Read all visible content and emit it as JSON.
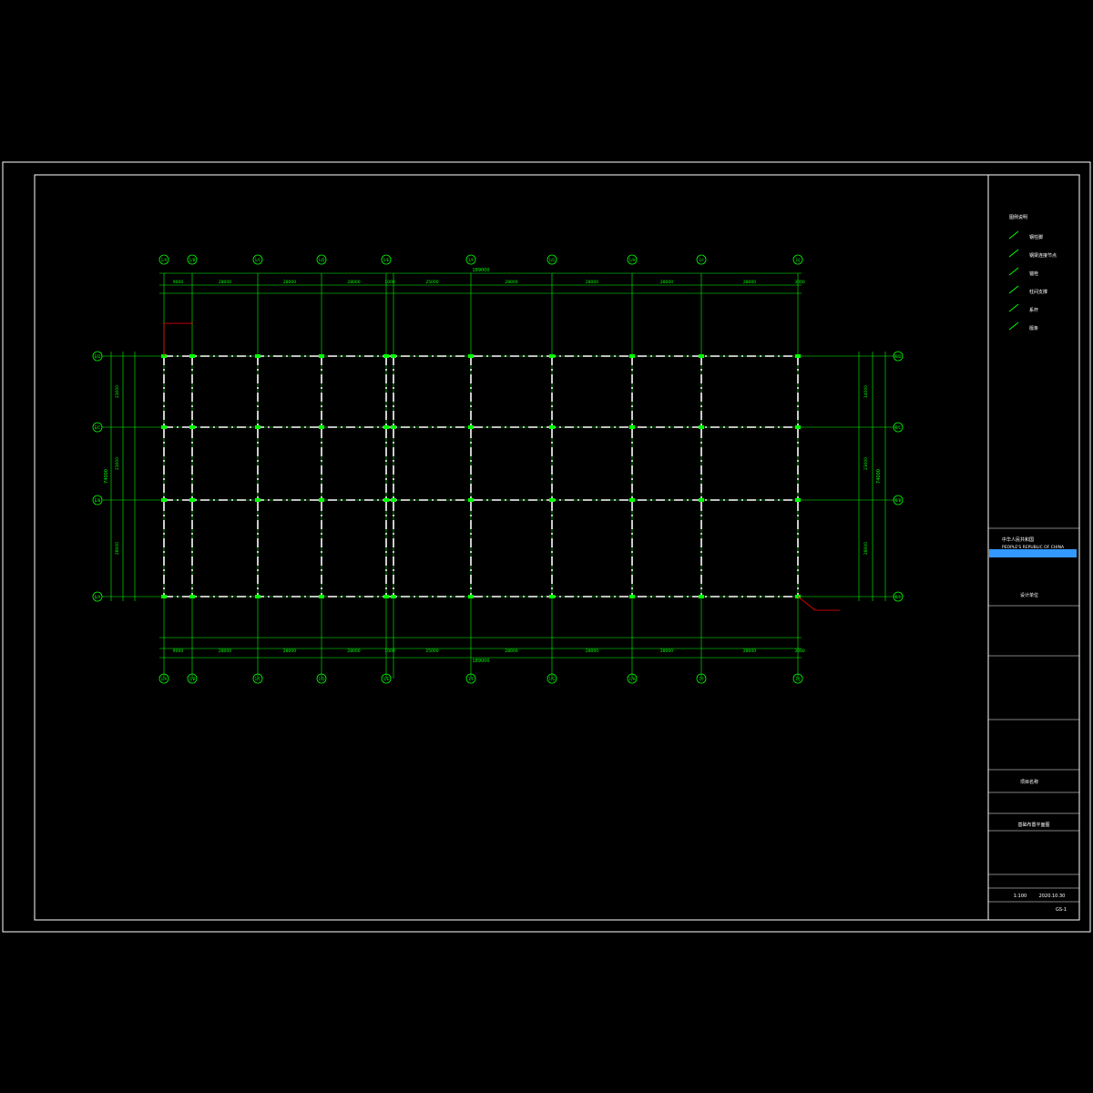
{
  "grid": {
    "top_axes": [
      "1/A",
      "1/B",
      "1/C",
      "1/D",
      "1/E",
      "1/F",
      "1/G",
      "1/H",
      "1/I",
      "1/J"
    ],
    "side_axes": [
      "E/D",
      "E/C",
      "E/B",
      "E/A"
    ]
  },
  "dims": {
    "top_row1": [
      "9000",
      "28000",
      "28000",
      "28000",
      "1000",
      "25000",
      "28000",
      "28000",
      "28000",
      "28000",
      "3000"
    ],
    "top_total": "189000",
    "bottom_row": [
      "9000",
      "28000",
      "28000",
      "28000",
      "1000",
      "25000",
      "28000",
      "28000",
      "28000",
      "28000",
      "3000"
    ],
    "bottom_total": "189000",
    "left_span": [
      "23000",
      "23000",
      "28000"
    ],
    "left_total": "74000",
    "right_span": [
      "14000",
      "23000",
      "28000"
    ],
    "right_total": "74000"
  },
  "legend": {
    "title": "图例说明",
    "items": [
      "钢柱脚",
      "钢梁连接节点",
      "锚栓",
      "柱间支撑",
      "系杆",
      "檩条"
    ]
  },
  "title_block": {
    "company_cn": "中华人民共和国",
    "company_en": "PEOPLE'S REPUBLIC OF CHINA",
    "designer": "设计单位",
    "project_label": "项目名称",
    "drawing_title": "基础布置平面图",
    "scale": "1:100",
    "date": "2020.10.30",
    "sheet_no": "GS-1"
  },
  "colors": {
    "line": "#00ff00",
    "frame": "#ffffff",
    "accent": "#ff0000",
    "blue": "#3399ff"
  }
}
